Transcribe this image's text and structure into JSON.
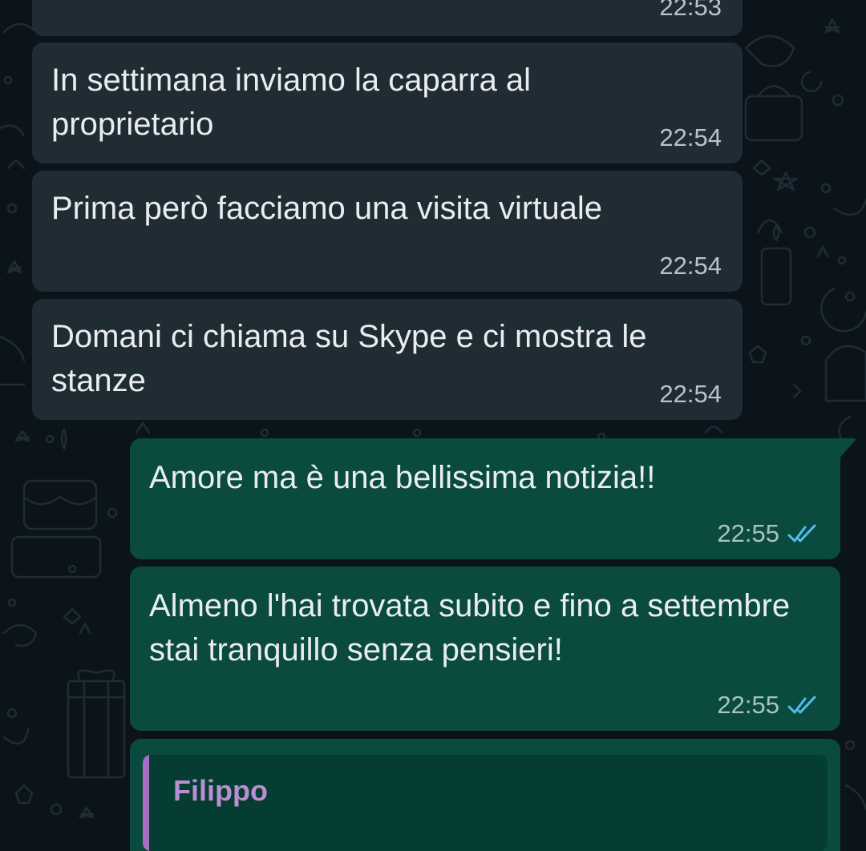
{
  "theme": {
    "background": "#0b141a",
    "incoming_bubble": "#202c33",
    "outgoing_bubble": "#0a4a3f",
    "text": "#e9edef",
    "read_ticks": "#53bdeb",
    "quote_accent": "#a66ec2"
  },
  "messages": [
    {
      "direction": "incoming",
      "text": "",
      "time": "22:53"
    },
    {
      "direction": "incoming",
      "text": "In settimana inviamo la caparra al proprietario",
      "time": "22:54"
    },
    {
      "direction": "incoming",
      "text": "Prima però facciamo una visita virtuale",
      "time": "22:54"
    },
    {
      "direction": "incoming",
      "text": "Domani ci chiama su Skype e ci mostra le stanze",
      "time": "22:54"
    },
    {
      "direction": "outgoing",
      "text": "Amore ma è una bellissima notizia!!",
      "time": "22:55",
      "status_icon": "double-check-read-icon"
    },
    {
      "direction": "outgoing",
      "text": "Almeno l'hai trovata subito e fino a settembre stai tranquillo senza pensieri!",
      "time": "22:55",
      "status_icon": "double-check-read-icon"
    }
  ],
  "reply_preview": {
    "author": "Filippo"
  }
}
